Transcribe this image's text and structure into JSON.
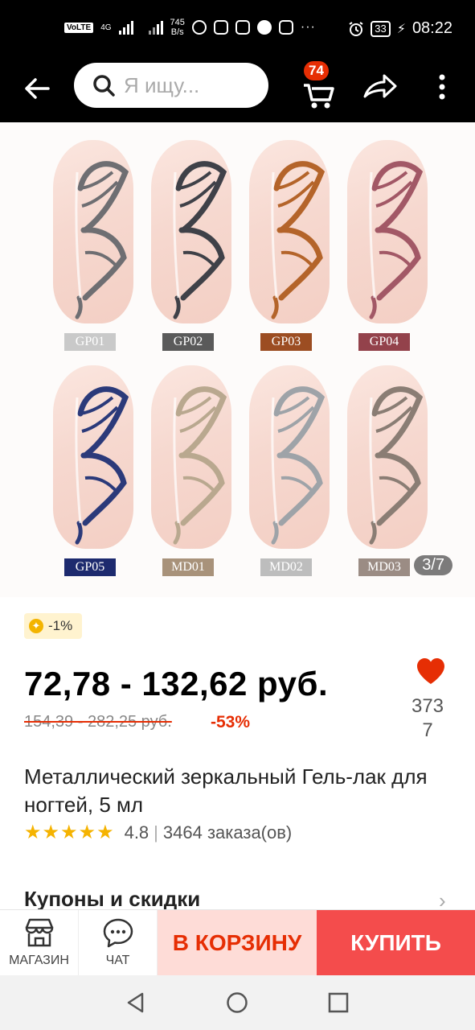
{
  "status_bar": {
    "volte": "VoLTE",
    "network": "4G",
    "speed_value": "745",
    "speed_unit": "B/s",
    "battery": "33",
    "time": "08:22",
    "more": "···"
  },
  "header": {
    "search_placeholder": "Я ищу...",
    "cart_badge": "74"
  },
  "gallery": {
    "swatches": [
      {
        "code": "GP01",
        "tag_color": "#c9c9c9",
        "stroke": "#6e6e72"
      },
      {
        "code": "GP02",
        "tag_color": "#5a5a5a",
        "stroke": "#3f4148"
      },
      {
        "code": "GP03",
        "tag_color": "#9c4d22",
        "stroke": "#b4642a"
      },
      {
        "code": "GP04",
        "tag_color": "#93424b",
        "stroke": "#a25866"
      },
      {
        "code": "GP05",
        "tag_color": "#1d2a6e",
        "stroke": "#2b3a7a"
      },
      {
        "code": "MD01",
        "tag_color": "#a8927a",
        "stroke": "#b9a88f"
      },
      {
        "code": "MD02",
        "tag_color": "#bdbdbd",
        "stroke": "#9ea3a8"
      },
      {
        "code": "MD03",
        "tag_color": "#9b8c84",
        "stroke": "#8a7d74"
      }
    ],
    "pager": "3/7"
  },
  "product": {
    "coin_discount": "-1%",
    "price": "72,78 - 132,62 руб.",
    "old_price": "154,39 - 282,25 руб.",
    "discount": "-53%",
    "wishlist_count": "3737",
    "title": "Металлический зеркальный Гель-лак для ногтей, 5 мл",
    "stars": "★★★★★",
    "rating": "4.8",
    "rating_sep": "|",
    "orders": "3464 заказа(ов)",
    "coupons_heading": "Купоны и скидки",
    "chevron": "›"
  },
  "action_bar": {
    "store_label": "МАГАЗИН",
    "chat_label": "ЧАТ",
    "add_to_cart": "В КОРЗИНУ",
    "buy_now": "КУПИТЬ"
  },
  "colors": {
    "accent": "#e62e04",
    "buy_button": "#f44c4c",
    "cart_button_bg": "#fedcd7",
    "star": "#f5b301"
  }
}
